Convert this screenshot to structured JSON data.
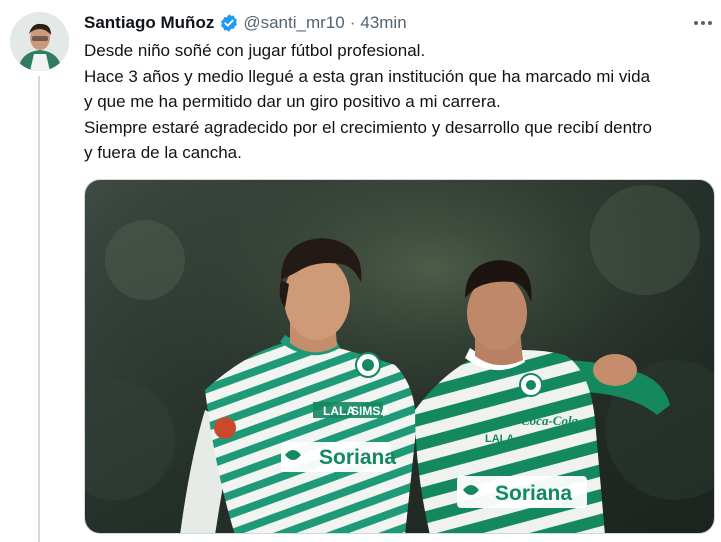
{
  "tweet": {
    "author_name": "Santiago Muñoz",
    "handle": "@santi_mr10",
    "separator": "·",
    "time": "43min",
    "lines": [
      "Desde niño soñé con jugar fútbol profesional.",
      "Hace 3 años y medio llegué a esta gran institución que ha marcado mi vida",
      "y que me ha permitido dar un giro positivo a mi carrera.",
      "Siempre estaré agradecido por el crecimiento y desarrollo que recibí dentro",
      "y fuera de la cancha."
    ],
    "icons": {
      "verified": "verified-badge-icon",
      "more": "more-options-icon"
    }
  },
  "photo": {
    "left_jersey": {
      "sponsor_main": "Soriana",
      "sponsor_chest": "SIMSA",
      "sponsor_small": "LALA"
    },
    "right_jersey": {
      "sponsor_main": "Soriana",
      "sponsor_chest": "Coca-Cola",
      "sponsor_small": "LALA"
    }
  },
  "colors": {
    "verified": "#1d9bf0",
    "name_text": "#0f1419",
    "secondary_text": "#536471",
    "thread_line": "#cfd9de",
    "jersey_green": "#14885f"
  }
}
